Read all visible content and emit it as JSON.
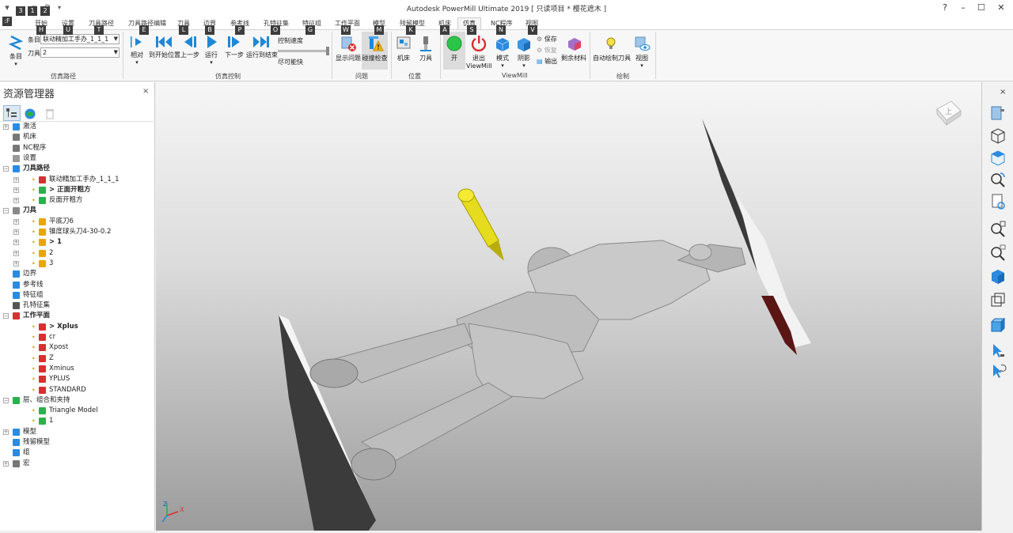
{
  "window": {
    "title": "Autodesk PowerMill Ultimate 2019   [ 只读项目 * 樱花遮木 ]",
    "help": "?",
    "minimize": "–",
    "maximize": "☐",
    "close": "✕"
  },
  "quick_access_keytips": [
    ":F",
    "1",
    "2",
    "3"
  ],
  "tabs": [
    {
      "label": "开始",
      "key": "H"
    },
    {
      "label": "设置",
      "key": "U"
    },
    {
      "label": "刀具路径",
      "key": "T"
    },
    {
      "label": "刀具路径编辑",
      "key": "E"
    },
    {
      "label": "刀具",
      "key": "L"
    },
    {
      "label": "边界",
      "key": "B"
    },
    {
      "label": "参考线",
      "key": "P"
    },
    {
      "label": "孔特征集",
      "key": "O"
    },
    {
      "label": "特征组",
      "key": "G"
    },
    {
      "label": "工作平面",
      "key": "W"
    },
    {
      "label": "模型",
      "key": "M"
    },
    {
      "label": "残留模型",
      "key": "K"
    },
    {
      "label": "机床",
      "key": "A"
    },
    {
      "label": "仿真",
      "key": "S"
    },
    {
      "label": "NC程序",
      "key": "N"
    },
    {
      "label": "视图",
      "key": "V"
    }
  ],
  "ribbon": {
    "sim_path": {
      "entry_button": "条目",
      "entry_label": "条目",
      "entry_value": "联动精加工手办_1_1_1",
      "tool_label": "刀具",
      "tool_value": "2",
      "group_label": "仿真路径"
    },
    "sim_control": {
      "relative": "相对",
      "to_start": "到开始位置",
      "step_back": "上一步",
      "run": "运行",
      "step_forward": "下一步",
      "run_to_end": "运行到结束",
      "speed_label": "控制速度",
      "fast_label": "尽可能快",
      "group_label": "仿真控制"
    },
    "problems": {
      "show_problems": "显示问题",
      "collision_check": "碰撞检查",
      "group_label": "问题"
    },
    "position": {
      "machine": "机床",
      "tool": "刀具",
      "group_label": "位置"
    },
    "viewmill": {
      "on": "开",
      "exit_line1": "退出",
      "exit_line2": "ViewMill",
      "mode": "模式",
      "shading": "阴影",
      "save": "保存",
      "restore": "恢复",
      "output": "输出",
      "remaining_stock": "剩余材料",
      "group_label": "ViewMill"
    },
    "draw": {
      "auto_draw_tool": "自动绘制刀具",
      "view": "视图",
      "group_label": "绘制"
    }
  },
  "explorer": {
    "title": "资源管理器",
    "close": "×",
    "tree": [
      {
        "label": "激活",
        "level": 0,
        "exp": "+",
        "icon": "activate-icon",
        "bold": false
      },
      {
        "label": "机床",
        "level": 0,
        "exp": "",
        "icon": "machine-icon",
        "bold": false
      },
      {
        "label": "NC程序",
        "level": 0,
        "exp": "",
        "icon": "nc-program-icon",
        "bold": false
      },
      {
        "label": "设置",
        "level": 0,
        "exp": "",
        "icon": "settings-icon",
        "bold": false
      },
      {
        "label": "刀具路径",
        "level": 0,
        "exp": "−",
        "icon": "toolpath-icon",
        "bold": true
      },
      {
        "label": "联动精加工手办_1_1_1",
        "level": 1,
        "exp": "+",
        "icon": "toolpath-error-icon",
        "bold": false
      },
      {
        "label": "> 正面开粗方",
        "level": 1,
        "exp": "+",
        "icon": "toolpath-ok-icon",
        "bold": true
      },
      {
        "label": "反面开粗方",
        "level": 1,
        "exp": "+",
        "icon": "toolpath-ok-icon",
        "bold": false
      },
      {
        "label": "刀具",
        "level": 0,
        "exp": "−",
        "icon": "tool-icon",
        "bold": true
      },
      {
        "label": "平底刀6",
        "level": 1,
        "exp": "+",
        "icon": "endmill-icon",
        "bold": false
      },
      {
        "label": "锥度球头刀4-30-0.2",
        "level": 1,
        "exp": "+",
        "icon": "ballnose-icon",
        "bold": false
      },
      {
        "label": "> 1",
        "level": 1,
        "exp": "+",
        "icon": "ballnose-icon",
        "bold": true
      },
      {
        "label": "2",
        "level": 1,
        "exp": "+",
        "icon": "ballnose-icon",
        "bold": false
      },
      {
        "label": "3",
        "level": 1,
        "exp": "+",
        "icon": "endmill-icon",
        "bold": false
      },
      {
        "label": "边界",
        "level": 0,
        "exp": "",
        "icon": "boundary-icon",
        "bold": false
      },
      {
        "label": "参考线",
        "level": 0,
        "exp": "",
        "icon": "pattern-icon",
        "bold": false
      },
      {
        "label": "特征组",
        "level": 0,
        "exp": "",
        "icon": "feature-group-icon",
        "bold": false
      },
      {
        "label": "孔特征集",
        "level": 0,
        "exp": "",
        "icon": "hole-feature-icon",
        "bold": false
      },
      {
        "label": "工作平面",
        "level": 0,
        "exp": "−",
        "icon": "workplane-icon",
        "bold": true
      },
      {
        "label": "> Xplus",
        "level": 1,
        "exp": "",
        "icon": "workplane-icon",
        "bold": true
      },
      {
        "label": "cr",
        "level": 1,
        "exp": "",
        "icon": "workplane-icon",
        "bold": false
      },
      {
        "label": "Xpost",
        "level": 1,
        "exp": "",
        "icon": "workplane-icon",
        "bold": false
      },
      {
        "label": "Z",
        "level": 1,
        "exp": "",
        "icon": "workplane-icon",
        "bold": false
      },
      {
        "label": "Xminus",
        "level": 1,
        "exp": "",
        "icon": "workplane-icon",
        "bold": false
      },
      {
        "label": "YPLUS",
        "level": 1,
        "exp": "",
        "icon": "workplane-icon",
        "bold": false
      },
      {
        "label": "STANDARD",
        "level": 1,
        "exp": "",
        "icon": "workplane-icon",
        "bold": false
      },
      {
        "label": "层、组合和夹持",
        "level": 0,
        "exp": "−",
        "icon": "layer-icon",
        "bold": false
      },
      {
        "label": "Triangle Model",
        "level": 1,
        "exp": "",
        "icon": "layer-icon",
        "bold": false
      },
      {
        "label": "1",
        "level": 1,
        "exp": "",
        "icon": "layer-icon",
        "bold": false
      },
      {
        "label": "模型",
        "level": 0,
        "exp": "+",
        "icon": "model-icon",
        "bold": false
      },
      {
        "label": "残留模型",
        "level": 0,
        "exp": "",
        "icon": "stock-model-icon",
        "bold": false
      },
      {
        "label": "组",
        "level": 0,
        "exp": "",
        "icon": "group-icon",
        "bold": false
      },
      {
        "label": "宏",
        "level": 0,
        "exp": "+",
        "icon": "macro-icon",
        "bold": false
      }
    ]
  },
  "viewport": {
    "view_cube_label": "上",
    "triad_z": "Z",
    "triad_x": "X",
    "close": "×"
  },
  "right_toolbar": [
    "toolpath-view-icon",
    "iso-view-icon",
    "cube-view-icon",
    "zoom-rotate-icon",
    "page-refresh-icon",
    "zoom-fit-icon",
    "zoom-box-icon",
    "shaded-cube-icon",
    "wire-cube-icon",
    "blue-cube-icon",
    "select-arrow-icon",
    "undo-select-icon"
  ],
  "colors": {
    "accent_blue": "#1e88d8",
    "green_on": "#2bc44a",
    "red_exit": "#d83030",
    "tool_yellow": "#e6dc1e"
  }
}
